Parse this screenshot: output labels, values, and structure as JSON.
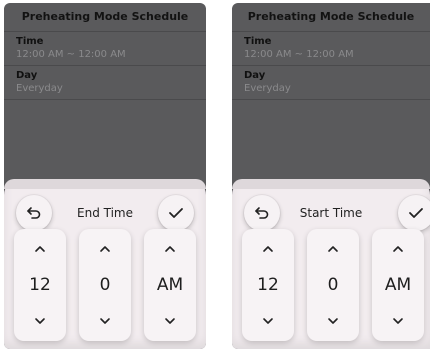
{
  "screens": [
    {
      "schedule_title": "Preheating Mode Schedule",
      "time_label": "Time",
      "time_value": "12:00 AM ~ 12:00 AM",
      "day_label": "Day",
      "day_value": "Everyday",
      "picker_title": "End Time",
      "hour": "12",
      "minute": "0",
      "ampm": "AM"
    },
    {
      "schedule_title": "Preheating Mode Schedule",
      "time_label": "Time",
      "time_value": "12:00 AM ~ 12:00 AM",
      "day_label": "Day",
      "day_value": "Everyday",
      "picker_title": "Start Time",
      "hour": "12",
      "minute": "0",
      "ampm": "AM"
    }
  ],
  "icons": {
    "back": "back-arrow-icon",
    "confirm": "checkmark-icon",
    "up": "chevron-up-icon",
    "down": "chevron-down-icon"
  }
}
